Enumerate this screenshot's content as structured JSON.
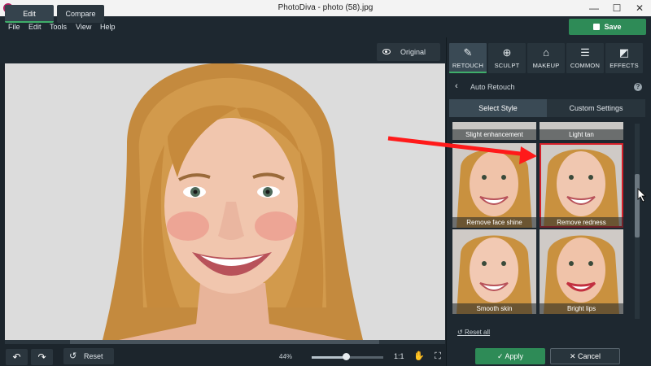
{
  "window": {
    "title": "PhotoDiva - photo (58).jpg",
    "minimize": "—",
    "maximize": "☐",
    "close": "✕"
  },
  "menu": [
    "File",
    "Edit",
    "Tools",
    "View",
    "Help"
  ],
  "save_label": "Save",
  "view_tabs": {
    "edit": "Edit",
    "compare": "Compare"
  },
  "original_label": "Original",
  "tools": [
    {
      "label": "RETOUCH",
      "icon": "retouch-icon",
      "glyph": "✎"
    },
    {
      "label": "SCULPT",
      "icon": "sculpt-icon",
      "glyph": "⊕"
    },
    {
      "label": "MAKEUP",
      "icon": "makeup-icon",
      "glyph": "⌂"
    },
    {
      "label": "COMMON",
      "icon": "sliders-icon",
      "glyph": "☰"
    },
    {
      "label": "EFFECTS",
      "icon": "effects-icon",
      "glyph": "◩"
    }
  ],
  "auto_retouch": {
    "title": "Auto Retouch",
    "help": "?"
  },
  "style_tabs": {
    "select": "Select Style",
    "custom": "Custom Settings"
  },
  "styles": [
    {
      "label": "Slight enhancement"
    },
    {
      "label": "Light tan"
    },
    {
      "label": "Remove face shine"
    },
    {
      "label": "Remove redness",
      "highlighted": true
    },
    {
      "label": "Smooth skin"
    },
    {
      "label": "Bright lips"
    }
  ],
  "reset_all": "Reset all",
  "apply_label": "Apply",
  "cancel_label": "Cancel",
  "reset_label": "Reset",
  "zoom": {
    "text": "44%",
    "one_to_one": "1:1"
  },
  "colors": {
    "accent": "#3fae6a",
    "save": "#2e8b57",
    "highlight": "#d6202a",
    "annotation_arrow": "#ff1a1a"
  }
}
